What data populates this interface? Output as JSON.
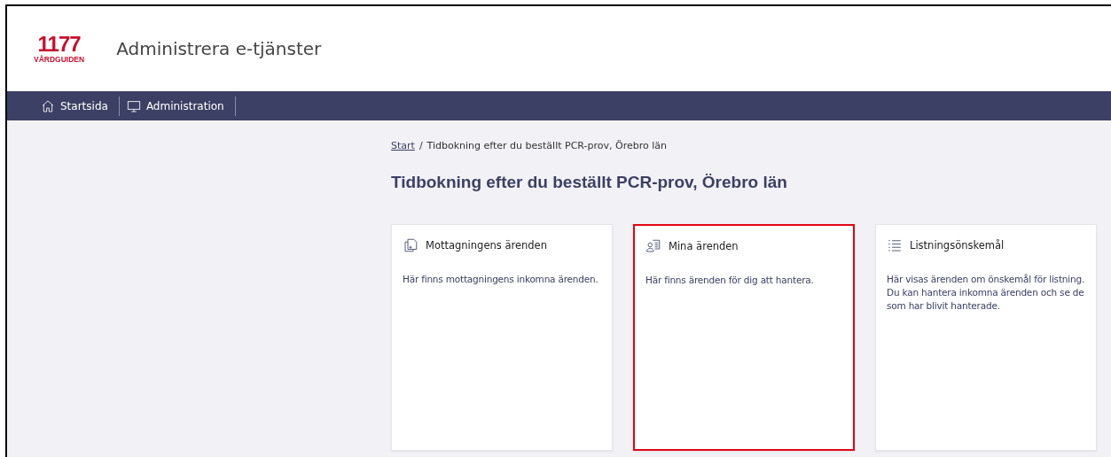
{
  "header": {
    "logo_number": "1177",
    "logo_text": "VÅRDGUIDEN",
    "title": "Administrera e-tjänster"
  },
  "nav": [
    {
      "label": "Startsida"
    },
    {
      "label": "Administration"
    }
  ],
  "breadcrumb": {
    "link": "Start",
    "separator": "/",
    "current": "Tidbokning efter du beställt PCR-prov, Örebro län"
  },
  "heading": "Tidbokning efter du beställt PCR-prov, Örebro län",
  "cards": [
    {
      "title": "Mottagningens ärenden",
      "text": "Här finns mottagningens inkomna ärenden.",
      "highlighted": false
    },
    {
      "title": "Mina ärenden",
      "text": "Här finns ärenden för dig att hantera.",
      "highlighted": true
    },
    {
      "title": "Listningsönskemål",
      "text": "Här visas ärenden om önskemål för listning. Du kan hantera inkomna ärenden och se de som har blivit hanterade.",
      "highlighted": false
    }
  ]
}
